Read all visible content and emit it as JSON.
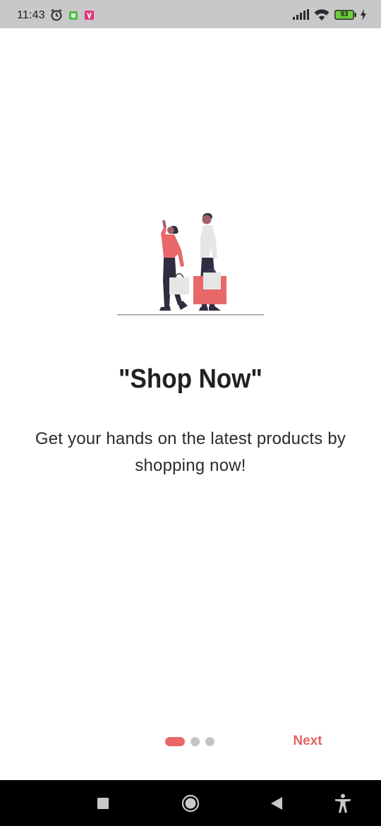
{
  "status_bar": {
    "time": "11:43",
    "battery_level": "93",
    "icons": [
      "alarm-icon",
      "app-notification-icon",
      "app-notification-icon",
      "signal-icon",
      "wifi-icon",
      "battery-icon",
      "charging-icon"
    ]
  },
  "onboarding": {
    "illustration": "shoppers-illustration",
    "title": "\"Shop Now\"",
    "description": "Get your hands on the latest products by shopping now!",
    "page_index": 1,
    "page_count": 3,
    "next_label": "Next"
  },
  "navigation_bar": {
    "icons": [
      "recent-apps-icon",
      "home-icon",
      "back-icon",
      "accessibility-icon"
    ]
  },
  "colors": {
    "accent": "#e8686a",
    "inactive_dot": "#c4c4c4",
    "status_bar": "#c8c8c8",
    "nav_bar": "#000000"
  }
}
